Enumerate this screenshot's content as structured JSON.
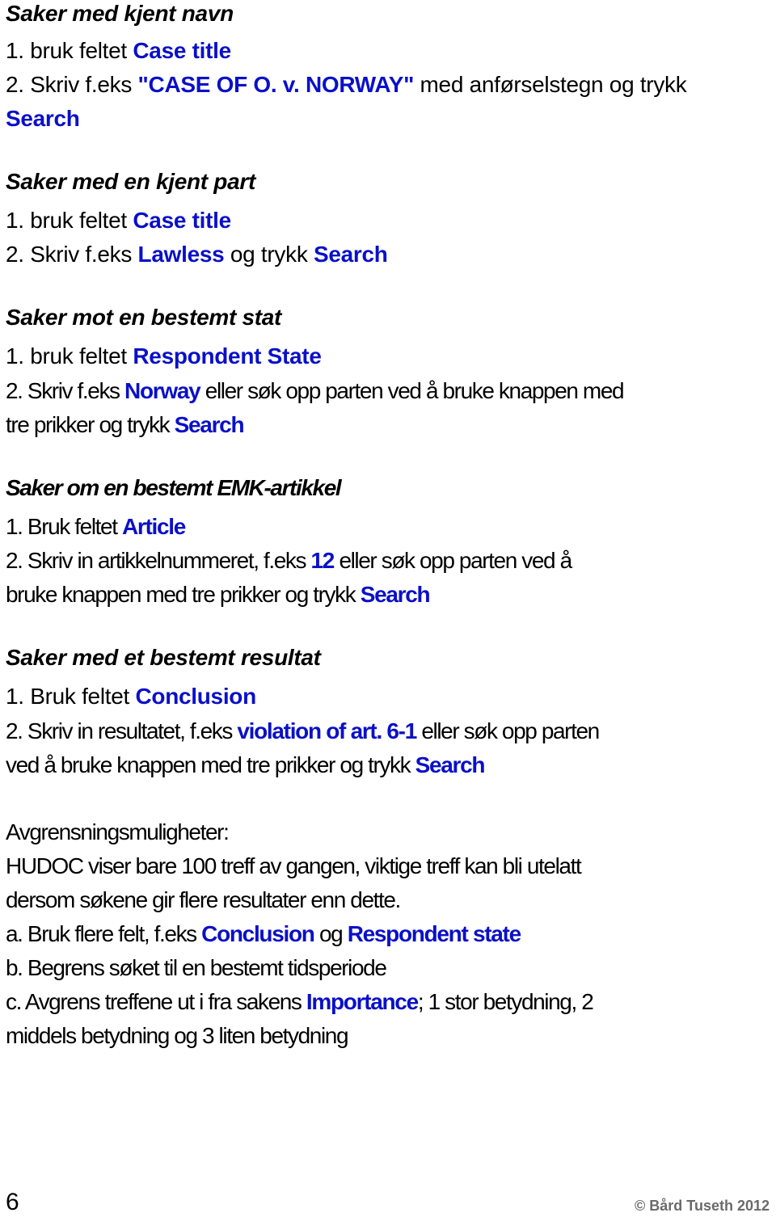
{
  "sections": [
    {
      "heading": "Saker med kjent navn",
      "lines": [
        [
          {
            "t": "1. bruk feltet "
          },
          {
            "t": "Case title",
            "hl": true
          }
        ],
        [
          {
            "t": "2. Skriv f.eks "
          },
          {
            "t": "\"CASE OF O. v. NORWAY\"",
            "hl": true
          },
          {
            "t": " med anførselstegn og trykk"
          }
        ],
        [
          {
            "t": "Search",
            "hl": true
          }
        ]
      ]
    },
    {
      "heading": "Saker med en kjent part",
      "lines": [
        [
          {
            "t": "1. bruk feltet "
          },
          {
            "t": "Case title",
            "hl": true
          }
        ],
        [
          {
            "t": "2. Skriv f.eks "
          },
          {
            "t": "Lawless",
            "hl": true
          },
          {
            "t": " og trykk "
          },
          {
            "t": "Search",
            "hl": true
          }
        ]
      ]
    },
    {
      "heading": "Saker mot en bestemt stat",
      "lines": [
        [
          {
            "t": "1. bruk feltet "
          },
          {
            "t": "Respondent State",
            "hl": true
          }
        ],
        [
          {
            "t": "2. Skriv f.eks "
          },
          {
            "t": "Norway",
            "hl": true
          },
          {
            "t": " eller søk opp parten ved å bruke knappen med"
          }
        ],
        [
          {
            "t": "tre prikker og trykk "
          },
          {
            "t": "Search",
            "hl": true
          }
        ]
      ]
    },
    {
      "heading": "Saker om en bestemt EMK-artikkel",
      "lines": [
        [
          {
            "t": "1. Bruk feltet "
          },
          {
            "t": "Article",
            "hl": true
          }
        ],
        [
          {
            "t": "2. Skriv in artikkelnummeret, f.eks "
          },
          {
            "t": "12",
            "hl": true
          },
          {
            "t": " eller søk opp parten ved å"
          }
        ],
        [
          {
            "t": "bruke knappen med tre prikker og trykk "
          },
          {
            "t": "Search",
            "hl": true
          }
        ]
      ]
    },
    {
      "heading": "Saker med et bestemt resultat",
      "lines": [
        [
          {
            "t": "1. Bruk feltet "
          },
          {
            "t": "Conclusion",
            "hl": true
          }
        ],
        [
          {
            "t": "2. Skriv in resultatet, f.eks "
          },
          {
            "t": "violation of art. 6-1",
            "hl": true
          },
          {
            "t": " eller søk opp parten"
          }
        ],
        [
          {
            "t": "ved å bruke knappen med tre prikker og trykk "
          },
          {
            "t": "Search",
            "hl": true
          }
        ]
      ]
    }
  ],
  "limits": {
    "lines": [
      [
        {
          "t": "Avgrensningsmuligheter:"
        }
      ],
      [
        {
          "t": "HUDOC viser bare 100 treff av gangen, viktige treff kan bli utelatt"
        }
      ],
      [
        {
          "t": "dersom søkene gir flere resultater enn dette."
        }
      ],
      [
        {
          "t": "a. Bruk flere felt, f.eks "
        },
        {
          "t": "Conclusion",
          "hl": true
        },
        {
          "t": " og "
        },
        {
          "t": "Respondent state",
          "hl": true
        }
      ],
      [
        {
          "t": "b. Begrens søket til en bestemt tidsperiode"
        }
      ],
      [
        {
          "t": "c. Avgrens treffene ut i fra sakens "
        },
        {
          "t": "Importance",
          "hl": true
        },
        {
          "t": "; 1 stor betydning, 2"
        }
      ],
      [
        {
          "t": "middels betydning og 3 liten betydning"
        }
      ]
    ]
  },
  "footer": {
    "page_number": "6",
    "copyright": "© Bård Tuseth 2012"
  },
  "colors": {
    "highlight": "#0a10c8",
    "text": "#000000",
    "footer": "#6b6b6b"
  }
}
